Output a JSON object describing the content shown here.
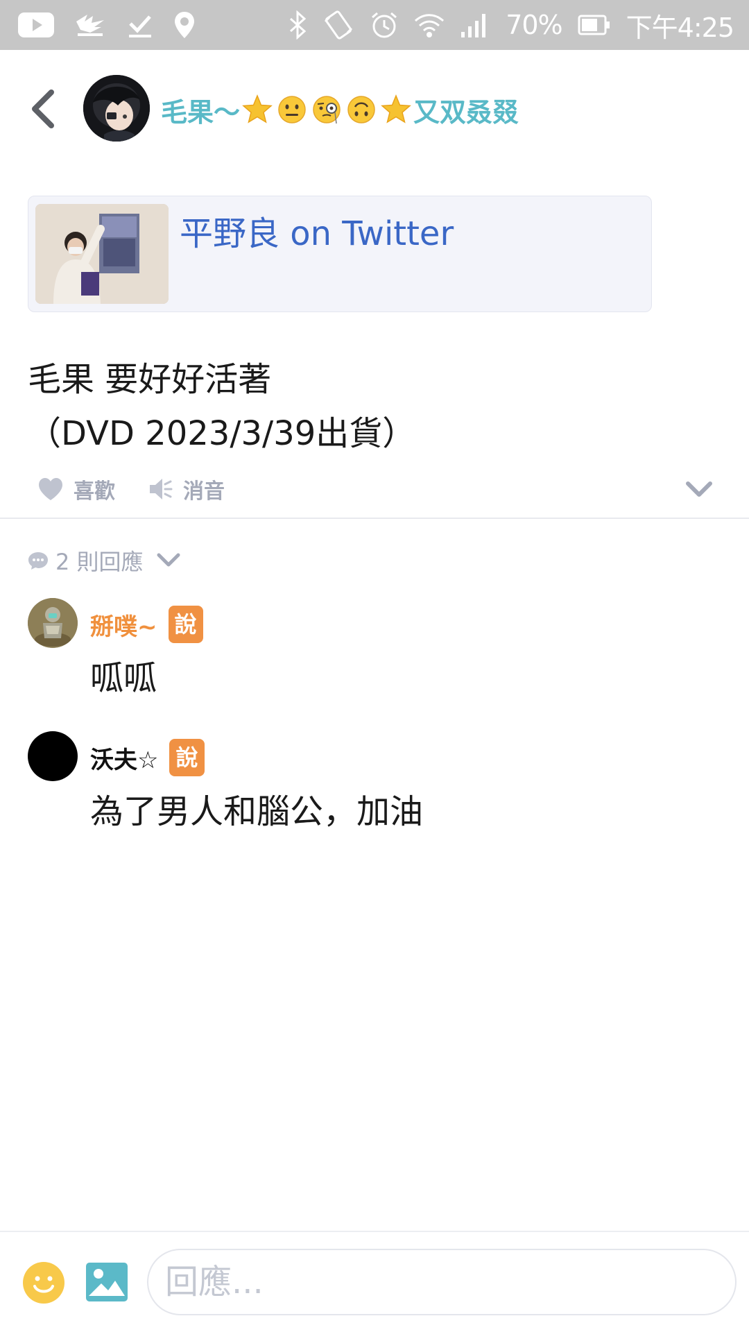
{
  "status_bar": {
    "battery_percent": "70%",
    "time": "下午4:25",
    "icons": [
      "youtube-icon",
      "capital-app-icon",
      "download-done-icon",
      "location-icon",
      "bluetooth-icon",
      "vibrate-icon",
      "alarm-icon",
      "wifi-icon",
      "signal-icon",
      "battery-icon"
    ],
    "background": "#c6c6c6"
  },
  "header": {
    "name_prefix": "毛果～",
    "name_emojis": [
      "star",
      "neutral-face",
      "monocle-face",
      "upside-down-face",
      "star"
    ],
    "name_suffix": "又双叒叕",
    "name_color": "#59b9c7"
  },
  "link_card": {
    "title": "平野良 on Twitter",
    "title_color": "#3a67c6"
  },
  "post": {
    "line1": "毛果 要好好活著",
    "line2": "（DVD 2023/3/39出貨）"
  },
  "actions": {
    "like_label": "喜歡",
    "mute_label": "消音"
  },
  "replies": {
    "count_label": "2 則回應"
  },
  "comments": [
    {
      "author": "掰噗~",
      "author_color": "#f0903d",
      "verb": "說",
      "text": "呱呱"
    },
    {
      "author": "沃夫☆",
      "author_color": "#111111",
      "verb": "說",
      "text": "為了男人和腦公，加油"
    }
  ],
  "composer": {
    "placeholder": "回應..."
  },
  "colors": {
    "badge": "#f09143",
    "muted": "#a4a9b8",
    "emoji_button": "#f8c94a",
    "image_button": "#5bb9c8"
  }
}
